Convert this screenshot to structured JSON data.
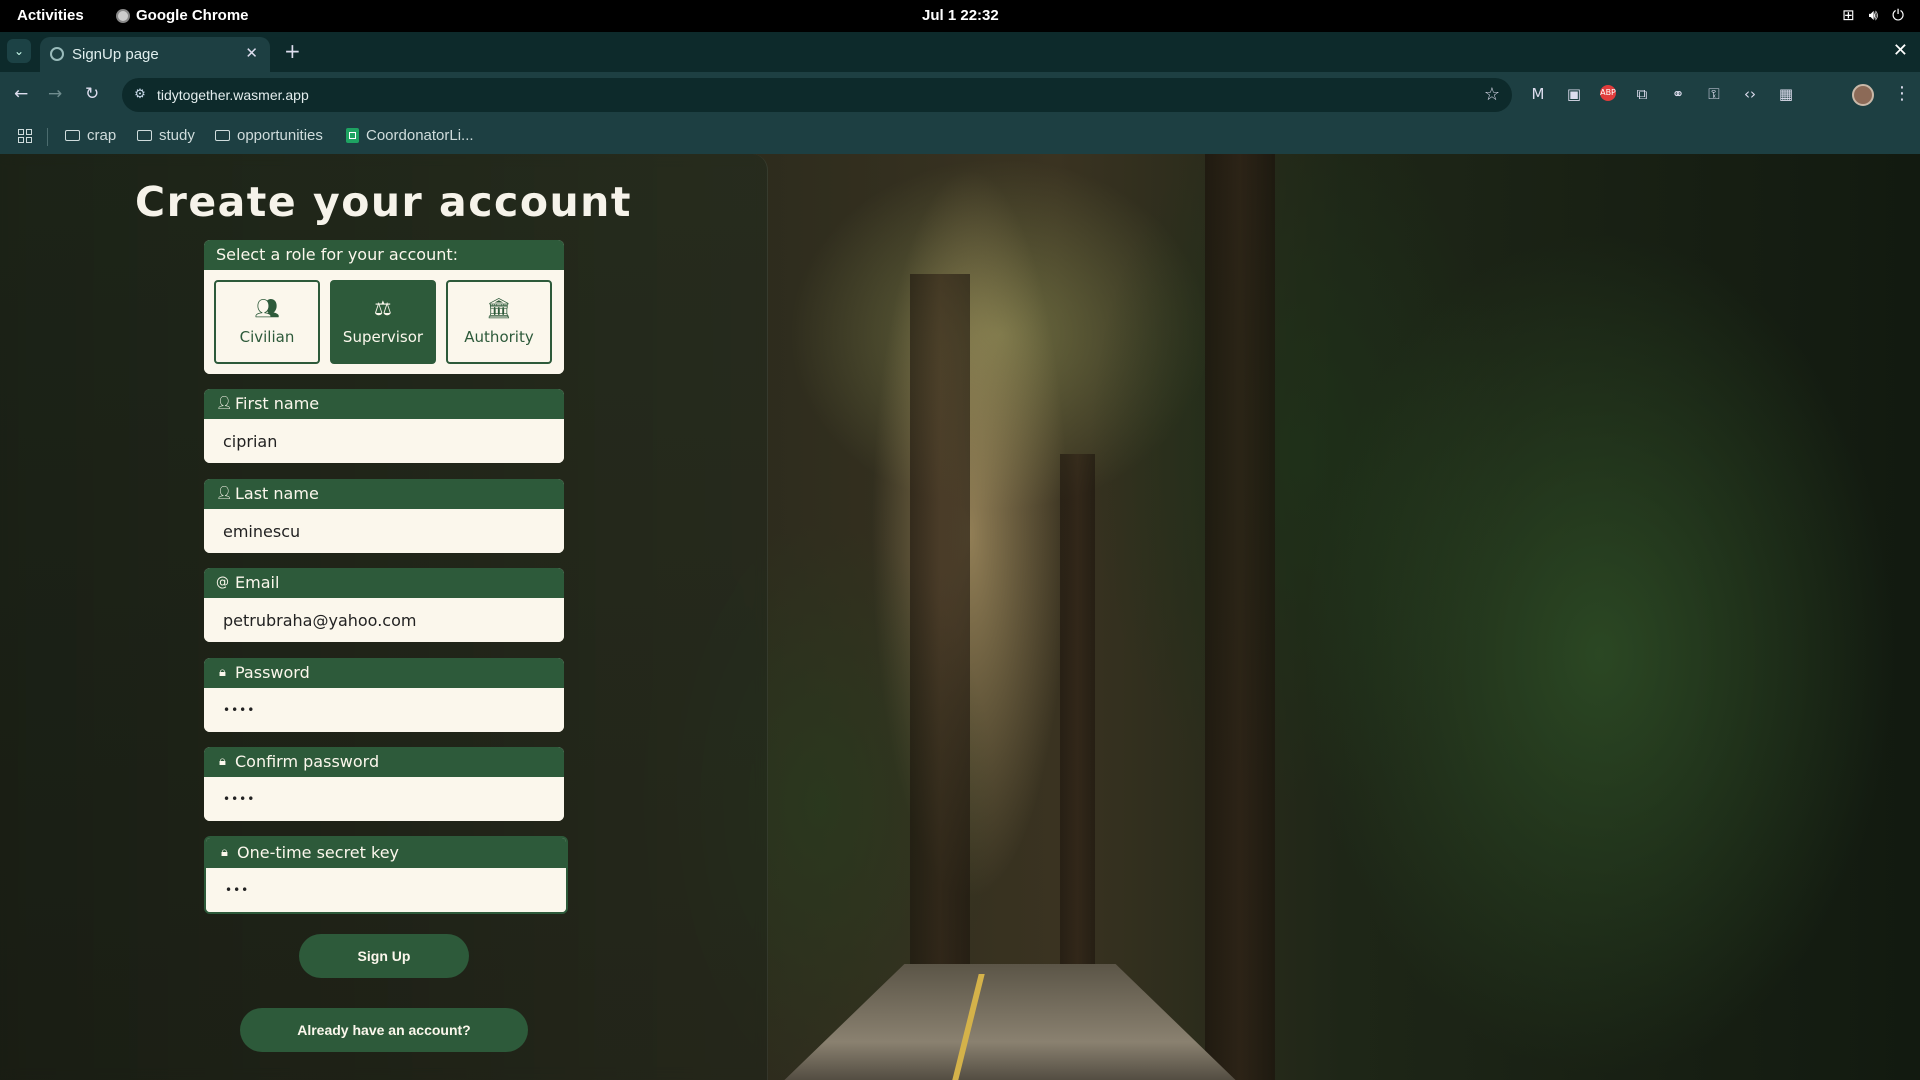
{
  "system_bar": {
    "activities": "Activities",
    "app_name": "Google Chrome",
    "clock": "Jul 1  22:32"
  },
  "browser": {
    "tab_title": "SignUp page",
    "url": "tidytogether.wasmer.app",
    "bookmarks": [
      "crap",
      "study",
      "opportunities",
      "CoordonatorLi..."
    ]
  },
  "page": {
    "heading": "Create your account",
    "role_section": {
      "label": "Select a role for your account:",
      "roles": [
        "Civilian",
        "Supervisor",
        "Authority"
      ],
      "selected": "Supervisor"
    },
    "fields": {
      "first_name": {
        "label": "First name",
        "value": "ciprian"
      },
      "last_name": {
        "label": "Last name",
        "value": "eminescu"
      },
      "email": {
        "label": "Email",
        "value": "petrubraha@yahoo.com"
      },
      "password": {
        "label": "Password",
        "value": "••••"
      },
      "confirm_password": {
        "label": "Confirm password",
        "value": "••••"
      },
      "secret_key": {
        "label": "One-time secret key",
        "value": "•••"
      }
    },
    "signup_button": "Sign Up",
    "login_button": "Already have an account?"
  },
  "colors": {
    "accent": "#2d5a3a",
    "field_bg": "#fbf7ec",
    "chrome_frame": "#1d3f42"
  }
}
